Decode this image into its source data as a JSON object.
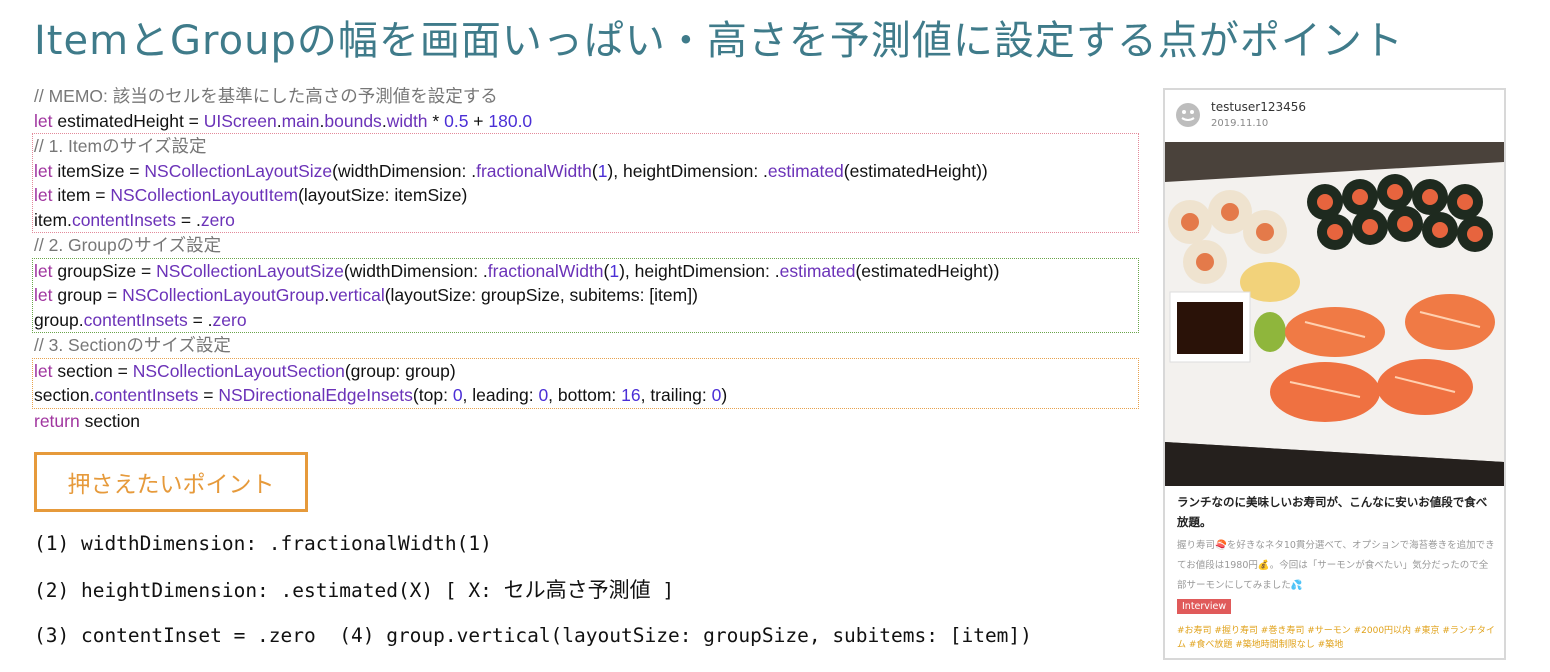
{
  "title": "ItemとGroupの幅を画面いっぱい・高さを予測値に設定する点がポイント",
  "code": {
    "memo": "// MEMO: 該当のセルを基準にした高さの予測値を設定する",
    "c1": "// 1. Itemのサイズ設定",
    "c2": "// 2. Groupのサイズ設定",
    "c3": "// 3. Sectionのサイズ設定"
  },
  "point_label": "押さえたいポイント",
  "points": {
    "p1": "(1) widthDimension: .fractionalWidth(1)",
    "p2_prefix": "(2) heightDimension: .estimated(X) [ X: ",
    "p2_jp": "セル高さ予測値",
    "p2_suffix": " ]",
    "p3": "(3) contentInset = .zero  (4) group.vertical(layoutSize: groupSize, subitems: [item])"
  },
  "card": {
    "username": "testuser123456",
    "date": "2019.11.10",
    "post_title": "ランチなのに美味しいお寿司が、こんなに安いお値段で食べ放題。",
    "post_body": "握り寿司🍣を好きなネタ10貫分選べて、オプションで海苔巻きを追加できてお値段は1980円💰。今回は「サーモンが食べたい」気分だったので全部サーモンにしてみました💦",
    "tag": "Interview",
    "hashtags": "#お寿司 #握り寿司 #巻き寿司 #サーモン #2000円以内 #東京 #ランチタイム #食べ放題 #築地時間制限なし #築地"
  },
  "colors": {
    "title": "#3f7b8a",
    "keyword": "#a0359f",
    "type": "#6b32b8",
    "item_box": "#e38a9a",
    "group_box": "#6aa54a",
    "section_box": "#e7a24e",
    "point_accent": "#e69a3b",
    "tag": "#e05a5a",
    "hashtag": "#e0a21b"
  }
}
